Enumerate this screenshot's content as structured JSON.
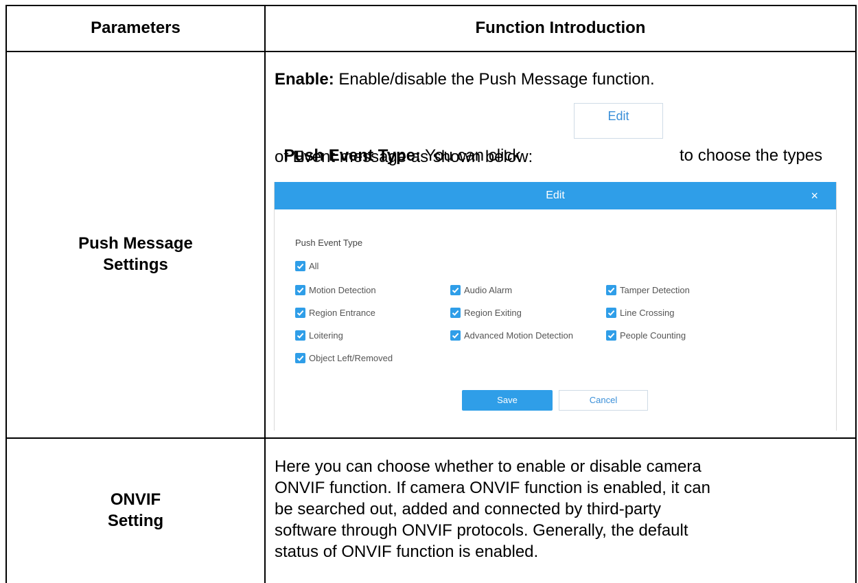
{
  "table": {
    "header_param": "Parameters",
    "header_func": "Function Introduction",
    "row1_label_line1": "Push Message",
    "row1_label_line2": "Settings",
    "row2_label_line1": "ONVIF",
    "row2_label_line2": "Setting"
  },
  "push": {
    "enable_label": "Enable:",
    "enable_text": " Enable/disable the Push Message function.",
    "type_label": "Push Event Type:",
    "type_text_before": " You can click ",
    "type_text_after": " to choose the types",
    "type_text_line2": "of Event message as shown below:",
    "edit_button": "Edit"
  },
  "dialog": {
    "title": "Edit",
    "close_glyph": "×",
    "section_title": "Push Event Type",
    "all_label": "All",
    "col1": [
      "Motion Detection",
      "Region Entrance",
      "Loitering",
      "Object Left/Removed"
    ],
    "col2": [
      "Audio Alarm",
      "Region Exiting",
      "Advanced Motion Detection"
    ],
    "col3": [
      "Tamper Detection",
      "Line Crossing",
      "People Counting"
    ],
    "save_label": "Save",
    "cancel_label": "Cancel",
    "accent_color": "#2f9ee8"
  },
  "onvif": {
    "line1": "Here you can choose whether to enable or disable camera",
    "line2": "ONVIF function. If camera ONVIF function is enabled, it can",
    "line3": "be searched out, added and connected by third-party",
    "line4": "software through ONVIF protocols. Generally, the default",
    "line5": "status of ONVIF function is enabled."
  }
}
